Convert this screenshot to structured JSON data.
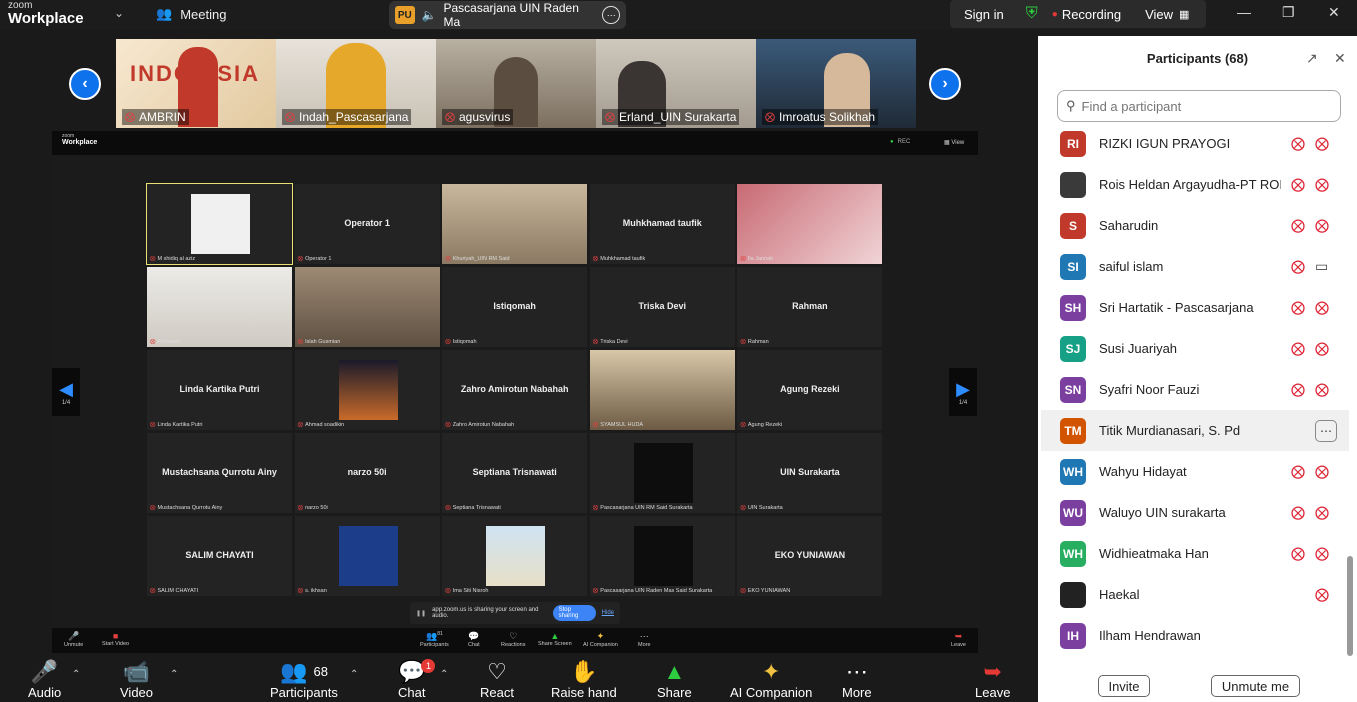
{
  "topbar": {
    "brand_small": "zoom",
    "brand_large": "Workplace",
    "meeting_label": "Meeting",
    "share_initials": "PU",
    "share_title": "Pascasarjana UIN Raden Ma",
    "sign_in": "Sign in",
    "recording": "Recording",
    "view": "View"
  },
  "strip": {
    "thumbnails": [
      {
        "name": "AMBRIN"
      },
      {
        "name": "Indah_Pascasarjana"
      },
      {
        "name": "agusvirus"
      },
      {
        "name": "Erland_UIN Surakarta"
      },
      {
        "name": "Imroatus Solikhah"
      }
    ]
  },
  "shared": {
    "brand_small": "zoom",
    "brand_large": "Workplace",
    "rec": "REC",
    "view": "View",
    "page": "1/4",
    "cells": [
      {
        "title": "",
        "label": "M shidiq al aziz"
      },
      {
        "title": "Operator 1",
        "label": "Operator 1"
      },
      {
        "title": "",
        "label": "Khuriyah_UIN RM Said"
      },
      {
        "title": "Muhkhamad taufik",
        "label": "Muhkhamad taufik"
      },
      {
        "title": "",
        "label": "Ila Jannah"
      },
      {
        "title": "",
        "label": "Purwanto"
      },
      {
        "title": "",
        "label": "Islah Gusmian"
      },
      {
        "title": "Istiqomah",
        "label": "Istiqomah"
      },
      {
        "title": "Triska Devi",
        "label": "Triska Devi"
      },
      {
        "title": "Rahman",
        "label": "Rahman"
      },
      {
        "title": "Linda Kartika Putri",
        "label": "Linda Kartika Putri"
      },
      {
        "title": "",
        "label": "Ahmad soadikin"
      },
      {
        "title": "Zahro Amirotun Nabahah",
        "label": "Zahro Amirotun Nabahah"
      },
      {
        "title": "",
        "label": "SYAMSUL HUDA"
      },
      {
        "title": "Agung Rezeki",
        "label": "Agung Rezeki"
      },
      {
        "title": "Mustachsana Qurrotu Ainy",
        "label": "Mustachsana Qurrotu Ainy"
      },
      {
        "title": "narzo 50i",
        "label": "narzo 50i"
      },
      {
        "title": "Septiana Trisnawati",
        "label": "Septiana Trisnawati"
      },
      {
        "title": "",
        "label": "Pascasarjana UIN RM Said Surakarta"
      },
      {
        "title": "UIN Surakarta",
        "label": "UIN Surakarta"
      },
      {
        "title": "SALIM CHAYATI",
        "label": "SALIM CHAYATI"
      },
      {
        "title": "",
        "label": "s. ikhsan"
      },
      {
        "title": "",
        "label": "Ima Siti Nisroh"
      },
      {
        "title": "",
        "label": "Pascasarjana UIN Raden Mas Said Surakarta"
      },
      {
        "title": "EKO YUNIAWAN",
        "label": "EKO YUNIAWAN"
      }
    ],
    "popup_text": "app.zoom.us is sharing your screen and audio.",
    "popup_stop": "Stop sharing",
    "popup_hide": "Hide",
    "mini_items": [
      "Unmute",
      "Start Video",
      "Participants",
      "Chat",
      "Reactions",
      "Share Screen",
      "AI Companion",
      "More",
      "Leave"
    ],
    "mini_participants_count": "81"
  },
  "toolbar": {
    "audio": "Audio",
    "video": "Video",
    "participants": "Participants",
    "participants_count": "68",
    "chat": "Chat",
    "chat_badge": "1",
    "react": "React",
    "raise_hand": "Raise hand",
    "share": "Share",
    "ai_companion": "AI Companion",
    "more": "More",
    "leave": "Leave"
  },
  "panel": {
    "title": "Participants (68)",
    "search_placeholder": "Find a participant",
    "participants": [
      {
        "initials": "RI",
        "name": "RIZKI IGUN PRAYOGI",
        "color": "#c0392b",
        "cam": "off",
        "mic": "off"
      },
      {
        "initials": "",
        "name": "Rois Heldan Argayudha-PT ROI...",
        "color": "#3a3a3a",
        "cam": "off",
        "mic": "off"
      },
      {
        "initials": "S",
        "name": "Saharudin",
        "color": "#c0392b",
        "cam": "off",
        "mic": "off"
      },
      {
        "initials": "SI",
        "name": "saiful islam",
        "color": "#1f77b4",
        "cam": "on",
        "mic": "off"
      },
      {
        "initials": "SH",
        "name": "Sri Hartatik - Pascasarjana",
        "color": "#7b3fa0",
        "cam": "off",
        "mic": "off"
      },
      {
        "initials": "SJ",
        "name": "Susi Juariyah",
        "color": "#16a085",
        "cam": "off",
        "mic": "off"
      },
      {
        "initials": "SN",
        "name": "Syafri Noor Fauzi",
        "color": "#7b3fa0",
        "cam": "off",
        "mic": "off"
      },
      {
        "initials": "TM",
        "name": "Titik Murdianasari, S. Pd",
        "color": "#d35400",
        "cam": "",
        "mic": ""
      },
      {
        "initials": "WH",
        "name": "Wahyu Hidayat",
        "color": "#1f77b4",
        "cam": "off",
        "mic": "off"
      },
      {
        "initials": "WU",
        "name": "Waluyo UIN surakarta",
        "color": "#7b3fa0",
        "cam": "off",
        "mic": "off"
      },
      {
        "initials": "WH",
        "name": "Widhieatmaka Han",
        "color": "#27ae60",
        "cam": "off",
        "mic": "off"
      },
      {
        "initials": "",
        "name": "Haekal",
        "color": "#222222",
        "cam": "off",
        "mic": ""
      },
      {
        "initials": "IH",
        "name": "Ilham Hendrawan",
        "color": "#7b3fa0",
        "cam": "",
        "mic": ""
      }
    ],
    "invite": "Invite",
    "unmute_me": "Unmute me"
  }
}
